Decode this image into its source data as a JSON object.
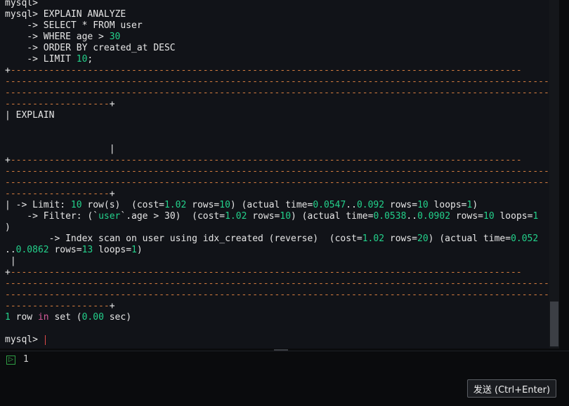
{
  "terminal": {
    "lines": [
      [
        {
          "t": "mysql>"
        }
      ],
      [
        {
          "t": "mysql> EXPLAIN ANALYZE"
        }
      ],
      [
        {
          "t": "    -> SELECT * FROM user"
        }
      ],
      [
        {
          "t": "    -> WHERE age > "
        },
        {
          "t": "30",
          "c": "n"
        }
      ],
      [
        {
          "t": "    -> ORDER BY created_at DESC"
        }
      ],
      [
        {
          "t": "    -> LIMIT "
        },
        {
          "t": "10",
          "c": "n"
        },
        {
          "t": ";"
        }
      ],
      [
        {
          "t": "+",
          "c": ""
        },
        {
          "t": "---------------------------------------------------------------------------------------------",
          "c": "d"
        }
      ],
      [
        {
          "t": "---------------------------------------------------------------------------------------------------",
          "c": "d"
        }
      ],
      [
        {
          "t": "---------------------------------------------------------------------------------------------------",
          "c": "d"
        }
      ],
      [
        {
          "t": "-------------------",
          "c": "d"
        },
        {
          "t": "+"
        }
      ],
      [
        {
          "t": "| EXPLAIN"
        }
      ],
      [
        {
          "t": ""
        }
      ],
      [
        {
          "t": ""
        }
      ],
      [
        {
          "t": "                   |"
        }
      ],
      [
        {
          "t": "+"
        },
        {
          "t": "---------------------------------------------------------------------------------------------",
          "c": "d"
        }
      ],
      [
        {
          "t": "---------------------------------------------------------------------------------------------------",
          "c": "d"
        }
      ],
      [
        {
          "t": "---------------------------------------------------------------------------------------------------",
          "c": "d"
        }
      ],
      [
        {
          "t": "-------------------",
          "c": "d"
        },
        {
          "t": "+"
        }
      ],
      [
        {
          "t": "| -> Limit: "
        },
        {
          "t": "10",
          "c": "n"
        },
        {
          "t": " row(s)  (cost="
        },
        {
          "t": "1.02",
          "c": "n"
        },
        {
          "t": " rows="
        },
        {
          "t": "10",
          "c": "n"
        },
        {
          "t": ") (actual time="
        },
        {
          "t": "0.0547",
          "c": "n"
        },
        {
          "t": ".."
        },
        {
          "t": "0.092",
          "c": "n"
        },
        {
          "t": " rows="
        },
        {
          "t": "10",
          "c": "n"
        },
        {
          "t": " loops="
        },
        {
          "t": "1",
          "c": "n"
        },
        {
          "t": ")"
        }
      ],
      [
        {
          "t": "    -> Filter: (`"
        },
        {
          "t": "user",
          "c": "s"
        },
        {
          "t": "`.age > 30)  (cost="
        },
        {
          "t": "1.02",
          "c": "n"
        },
        {
          "t": " rows="
        },
        {
          "t": "10",
          "c": "n"
        },
        {
          "t": ") (actual time="
        },
        {
          "t": "0.0538",
          "c": "n"
        },
        {
          "t": ".."
        },
        {
          "t": "0.0902",
          "c": "n"
        },
        {
          "t": " rows="
        },
        {
          "t": "10",
          "c": "n"
        },
        {
          "t": " loops="
        },
        {
          "t": "1",
          "c": "n"
        }
      ],
      [
        {
          "t": ")"
        }
      ],
      [
        {
          "t": "        -> Index scan on user using idx_created (reverse)  (cost="
        },
        {
          "t": "1.02",
          "c": "n"
        },
        {
          "t": " rows="
        },
        {
          "t": "20",
          "c": "n"
        },
        {
          "t": ") (actual time="
        },
        {
          "t": "0.052",
          "c": "n"
        }
      ],
      [
        {
          "t": ".."
        },
        {
          "t": "0.0862",
          "c": "n"
        },
        {
          "t": " rows="
        },
        {
          "t": "13",
          "c": "n"
        },
        {
          "t": " loops="
        },
        {
          "t": "1",
          "c": "n"
        },
        {
          "t": ")"
        }
      ],
      [
        {
          "t": " |"
        }
      ],
      [
        {
          "t": "+"
        },
        {
          "t": "---------------------------------------------------------------------------------------------",
          "c": "d"
        }
      ],
      [
        {
          "t": "---------------------------------------------------------------------------------------------------",
          "c": "d"
        }
      ],
      [
        {
          "t": "---------------------------------------------------------------------------------------------------",
          "c": "d"
        }
      ],
      [
        {
          "t": "-------------------",
          "c": "d"
        },
        {
          "t": "+"
        }
      ],
      [
        {
          "t": "1",
          "c": "n"
        },
        {
          "t": " row "
        },
        {
          "t": "in",
          "c": "k"
        },
        {
          "t": " set ("
        },
        {
          "t": "0.00",
          "c": "n"
        },
        {
          "t": " sec)"
        }
      ],
      [
        {
          "t": ""
        }
      ],
      [
        {
          "t": "mysql> "
        }
      ]
    ]
  },
  "input": {
    "icon": "terminal-input-icon",
    "icon_glyph": "▷",
    "text": "1"
  },
  "send_button": {
    "label": "发送 (Ctrl+Enter)"
  }
}
